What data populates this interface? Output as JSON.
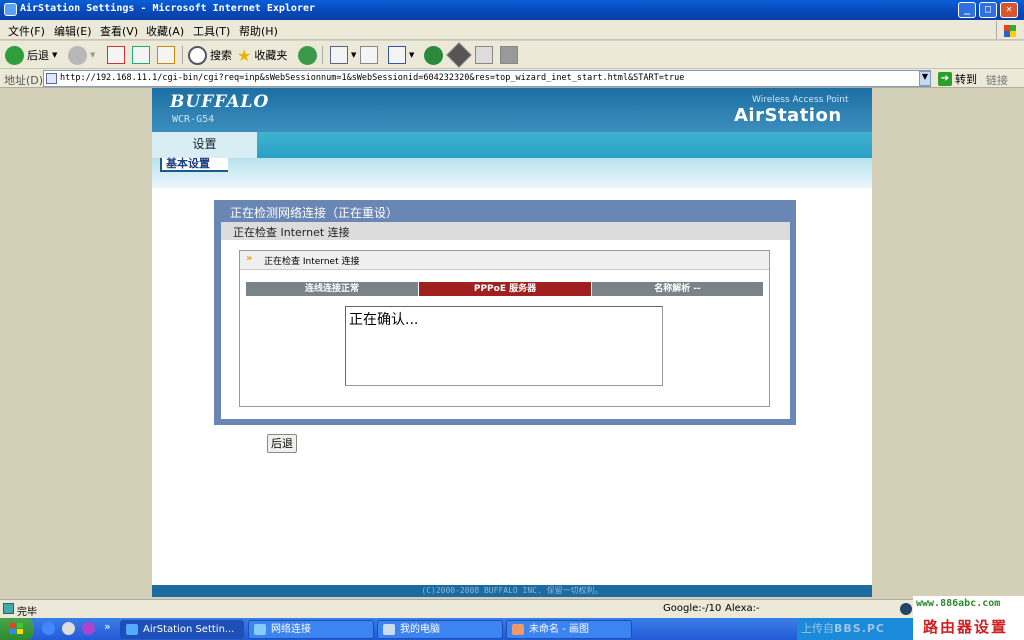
{
  "window": {
    "title": "AirStation Settings - Microsoft Internet Explorer"
  },
  "menu": [
    "文件(F)",
    "编辑(E)",
    "查看(V)",
    "收藏(A)",
    "工具(T)",
    "帮助(H)"
  ],
  "toolbar": {
    "back": "后退",
    "search": "搜索",
    "favorites": "收藏夹"
  },
  "address": {
    "label": "地址(D)",
    "url": "http://192.168.11.1/cgi-bin/cgi?req=inp&sWebSessionnum=1&sWebSessionid=604232320&res=top_wizard_inet_start.html&START=true",
    "go": "转到",
    "links": "链接"
  },
  "header": {
    "brand": "BUFFALO",
    "model": "WCR-G54",
    "product_line": "Wireless Access Point",
    "product": "AirStation"
  },
  "nav": {
    "tab": "设置",
    "subtab": "基本设置"
  },
  "dialog": {
    "title": "正在检测网络连接（正在重设）",
    "subtitle": "正在检查 Internet 连接",
    "panel_title": "正在检查 Internet 连接",
    "steps": [
      {
        "label": "连线连接正常",
        "color": "#7a8488"
      },
      {
        "label": "PPPoE 服务器",
        "color": "#a02020"
      },
      {
        "label": "名称解析 --",
        "color": "#7a8488"
      }
    ],
    "status": "正在确认..."
  },
  "buttons": {
    "back": "后退"
  },
  "footer": "(C)2000-2008 BUFFALO INC. 保留一切权利。",
  "statusbar": {
    "status": "完毕",
    "google": "Google:-/10",
    "alexa": "Alexa:-"
  },
  "taskbar": {
    "tasks": [
      "AirStation Settin...",
      "网络连接",
      "我的电脑",
      "未命名 - 画图"
    ],
    "tray": "上传自",
    "tray_bbs": "BBS.PC"
  },
  "watermark": {
    "url": "www.886abc.com",
    "name": "路由器设置"
  }
}
